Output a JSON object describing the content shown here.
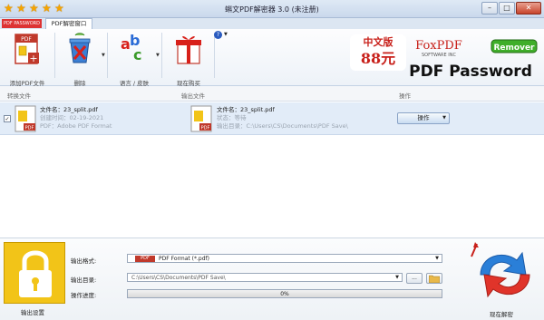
{
  "window": {
    "title": "蝌文PDF解密器 3.0 (未注册)",
    "stars": [
      "★",
      "★",
      "★",
      "★",
      "★"
    ],
    "controls": {
      "minimize": "–",
      "maximize": "□",
      "close": "✕"
    }
  },
  "tabs": {
    "logo": "PDF PASSWORD",
    "active": "PDF解密窗口"
  },
  "toolbar": {
    "add_label": "添加PDF文件",
    "delete_label": "删除",
    "language_label": "语言 / 皮肤",
    "buy_label": "现在购买"
  },
  "promo": {
    "edition": "中文版",
    "price": "88元",
    "brand": "FoxPDF",
    "brand_sub": "SOFTWARE INC",
    "remover": "Remover",
    "product": "PDF Password"
  },
  "table": {
    "headers": [
      "转换文件",
      "输出文件",
      "操作"
    ],
    "rows": [
      {
        "src_name": "文件名：23_split.pdf",
        "src_date": "创建时间：02-19-2021",
        "src_type": "PDF：Adobe PDF Format",
        "out_name": "文件名：23_split.pdf",
        "out_status": "状态：等待",
        "out_dir": "输出目录：C:\\Users\\CS\\Documents\\PDF Save\\",
        "action": "操作"
      }
    ]
  },
  "bottom": {
    "lock_caption": "输出设置",
    "format_label": "输出格式:",
    "format_tag": "PDF",
    "format_value": "PDF Format (*.pdf)",
    "dir_label": "输出目录:",
    "dir_value": "C:\\Users\\CS\\Documents\\PDF Save\\",
    "browse": "...",
    "progress_label": "操作进度:",
    "progress_text": "0%",
    "progress": 0,
    "decrypt_label": "现在解密"
  },
  "colors": {
    "accent": "#f2c418",
    "row_highlight": "#e2ecf8",
    "brand_red": "#d03020"
  }
}
